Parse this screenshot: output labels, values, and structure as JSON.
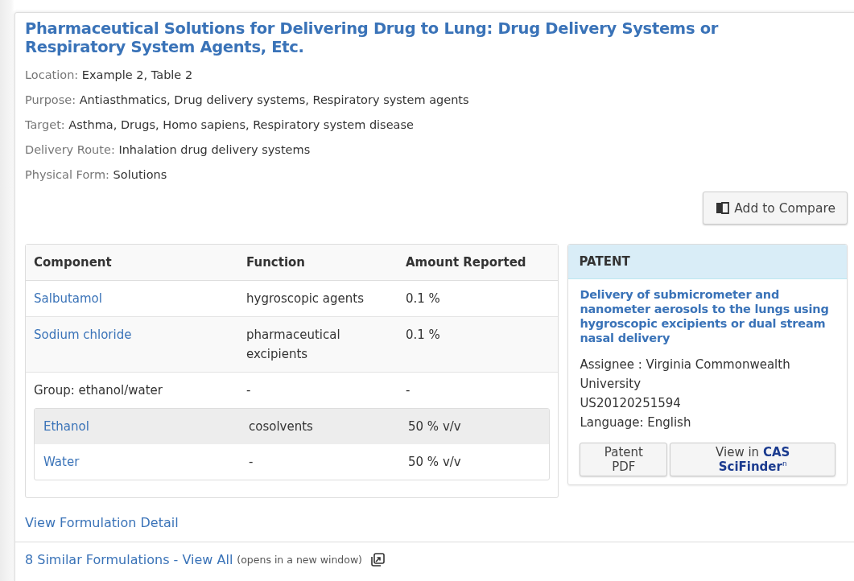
{
  "title": "Pharmaceutical Solutions for Delivering Drug to Lung: Drug Delivery Systems or Respiratory System Agents, Etc.",
  "fields": [
    {
      "label": "Location:",
      "value": "Example 2, Table 2"
    },
    {
      "label": "Purpose:",
      "value": "Antiasthmatics, Drug delivery systems, Respiratory system agents"
    },
    {
      "label": "Target:",
      "value": "Asthma, Drugs, Homo sapiens, Respiratory system disease"
    },
    {
      "label": "Delivery Route:",
      "value": "Inhalation drug delivery systems"
    },
    {
      "label": "Physical Form:",
      "value": "Solutions"
    }
  ],
  "compare_button": "Add to Compare",
  "table": {
    "columns": [
      "Component",
      "Function",
      "Amount Reported"
    ],
    "rows": [
      {
        "kind": "item",
        "cells": [
          "Salbutamol",
          "hygroscopic agents",
          "0.1 %"
        ]
      },
      {
        "kind": "item",
        "cells": [
          "Sodium chloride",
          "pharmaceutical excipients",
          "0.1 %"
        ]
      },
      {
        "kind": "group",
        "cells": [
          "Group: ethanol/water",
          "-",
          "-"
        ],
        "children": [
          {
            "cells": [
              "Ethanol",
              "cosolvents",
              "50 % v/v"
            ]
          },
          {
            "cells": [
              "Water",
              "-",
              "50 % v/v"
            ]
          }
        ]
      }
    ]
  },
  "patent": {
    "header": "PATENT",
    "title": "Delivery of submicrometer and nanometer aerosols to the lungs using hygroscopic excipients or dual stream nasal delivery",
    "lines": [
      "Assignee : Virginia Commonwealth University",
      "US20120251594",
      "Language: English"
    ],
    "buttons": [
      "Patent PDF",
      "View in **CAS SciFinder**$^{n}$"
    ]
  },
  "detail_link": "View Formulation Detail",
  "similar_link": "8 Similar Formulations - View All",
  "similar_note": "(opens in a new window)"
}
